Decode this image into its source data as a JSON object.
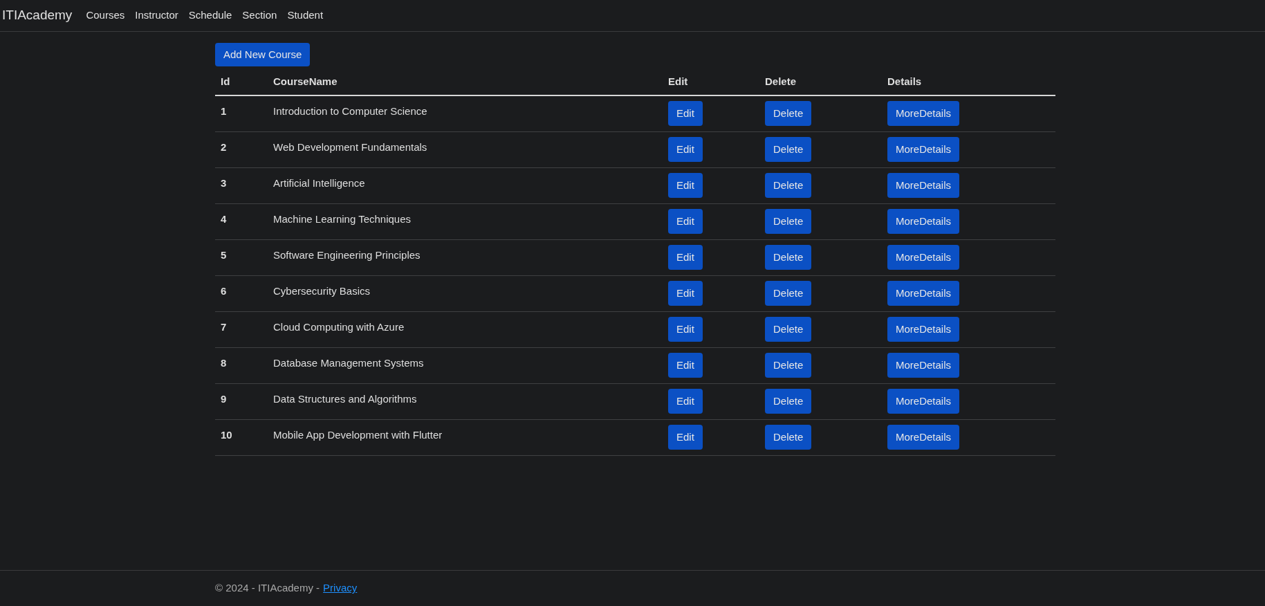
{
  "navbar": {
    "brand": "ITIAcademy",
    "links": [
      "Courses",
      "Instructor",
      "Schedule",
      "Section",
      "Student"
    ]
  },
  "add_button": "Add New Course",
  "table": {
    "columns": [
      "Id",
      "CourseName",
      "Edit",
      "Delete",
      "Details"
    ],
    "rows": [
      {
        "id": "1",
        "course_name": "Introduction to Computer Science",
        "edit": "Edit",
        "delete": "Delete",
        "details": "MoreDetails"
      },
      {
        "id": "2",
        "course_name": "Web Development Fundamentals",
        "edit": "Edit",
        "delete": "Delete",
        "details": "MoreDetails"
      },
      {
        "id": "3",
        "course_name": "Artificial Intelligence",
        "edit": "Edit",
        "delete": "Delete",
        "details": "MoreDetails"
      },
      {
        "id": "4",
        "course_name": "Machine Learning Techniques",
        "edit": "Edit",
        "delete": "Delete",
        "details": "MoreDetails"
      },
      {
        "id": "5",
        "course_name": "Software Engineering Principles",
        "edit": "Edit",
        "delete": "Delete",
        "details": "MoreDetails"
      },
      {
        "id": "6",
        "course_name": "Cybersecurity Basics",
        "edit": "Edit",
        "delete": "Delete",
        "details": "MoreDetails"
      },
      {
        "id": "7",
        "course_name": "Cloud Computing with Azure",
        "edit": "Edit",
        "delete": "Delete",
        "details": "MoreDetails"
      },
      {
        "id": "8",
        "course_name": "Database Management Systems",
        "edit": "Edit",
        "delete": "Delete",
        "details": "MoreDetails"
      },
      {
        "id": "9",
        "course_name": "Data Structures and Algorithms",
        "edit": "Edit",
        "delete": "Delete",
        "details": "MoreDetails"
      },
      {
        "id": "10",
        "course_name": "Mobile App Development with Flutter",
        "edit": "Edit",
        "delete": "Delete",
        "details": "MoreDetails"
      }
    ]
  },
  "footer": {
    "text": "© 2024 - ITIAcademy -",
    "link": "Privacy"
  }
}
